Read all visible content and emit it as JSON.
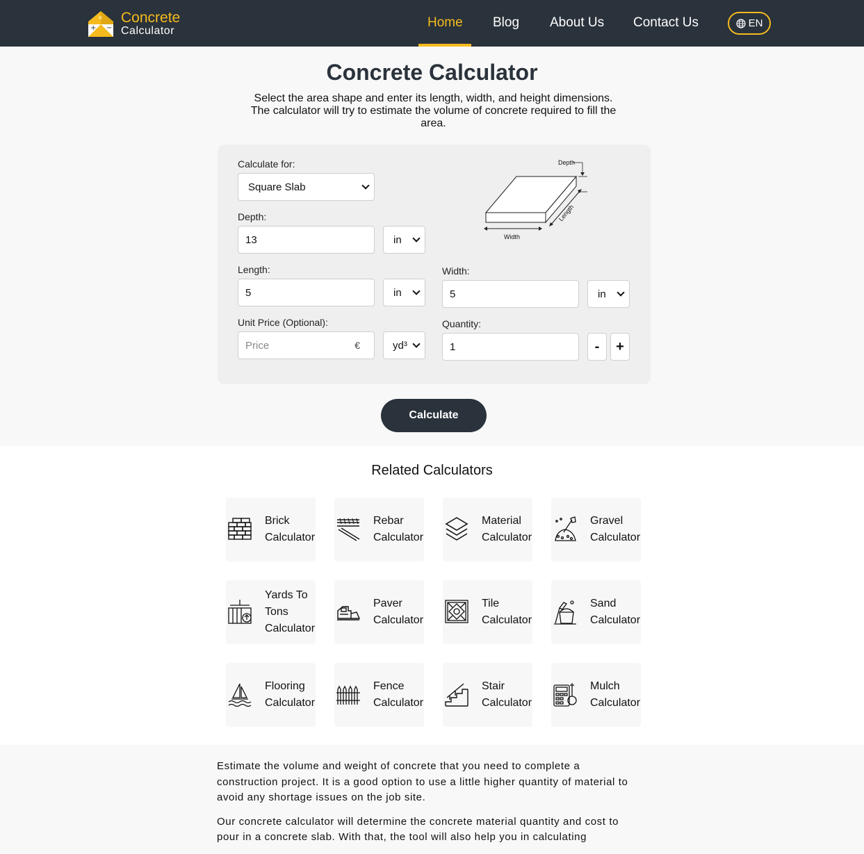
{
  "header": {
    "logo_line1": "Concrete",
    "logo_line2": "Calculator",
    "nav": [
      "Home",
      "Blog",
      "About Us",
      "Contact Us"
    ],
    "active_nav": "Home",
    "language": "EN"
  },
  "intro": {
    "title": "Concrete Calculator",
    "description": "Select the area shape and enter its length, width, and height dimensions. The calculator will try to estimate the volume of concrete required to fill the area."
  },
  "form": {
    "calculate_for_label": "Calculate for:",
    "calculate_for_value": "Square Slab",
    "depth_label": "Depth:",
    "depth_value": "13",
    "depth_unit": "in",
    "length_label": "Length:",
    "length_value": "5",
    "length_unit": "in",
    "width_label": "Width:",
    "width_value": "5",
    "width_unit": "in",
    "unit_price_label": "Unit Price (Optional):",
    "unit_price_placeholder": "Price",
    "currency_symbol": "€",
    "price_unit": "yd³",
    "quantity_label": "Quantity:",
    "quantity_value": "1",
    "minus_label": "-",
    "plus_label": "+",
    "diagram_labels": {
      "depth": "Depth",
      "width": "Width",
      "length": "Length"
    },
    "calculate_button": "Calculate"
  },
  "related": {
    "title": "Related Calculators",
    "items": [
      {
        "label": "Brick Calculator",
        "icon": "brick-icon"
      },
      {
        "label": "Rebar Calculator",
        "icon": "rebar-icon"
      },
      {
        "label": "Material Calculator",
        "icon": "layers-icon"
      },
      {
        "label": "Gravel Calculator",
        "icon": "shovel-icon"
      },
      {
        "label": "Yards To Tons Calculator",
        "icon": "scale-icon"
      },
      {
        "label": "Paver Calculator",
        "icon": "paver-machine-icon"
      },
      {
        "label": "Tile Calculator",
        "icon": "tile-icon"
      },
      {
        "label": "Sand Calculator",
        "icon": "sand-bucket-icon"
      },
      {
        "label": "Flooring Calculator",
        "icon": "flooring-icon"
      },
      {
        "label": "Fence Calculator",
        "icon": "fence-icon"
      },
      {
        "label": "Stair Calculator",
        "icon": "stair-icon"
      },
      {
        "label": "Mulch Calculator",
        "icon": "calculator-icon"
      }
    ]
  },
  "article": {
    "p1": "Estimate the volume and weight of concrete that you need to complete a construction project. It is a good option to use a little higher quantity of material to avoid any shortage issues on the job site.",
    "p2": "Our concrete calculator will determine the concrete material quantity and cost to pour in a concrete slab. With that, the tool will also help you in calculating"
  },
  "colors": {
    "header_bg": "#2a323b",
    "accent": "#f5bb1e",
    "card_bg": "#efefef"
  }
}
